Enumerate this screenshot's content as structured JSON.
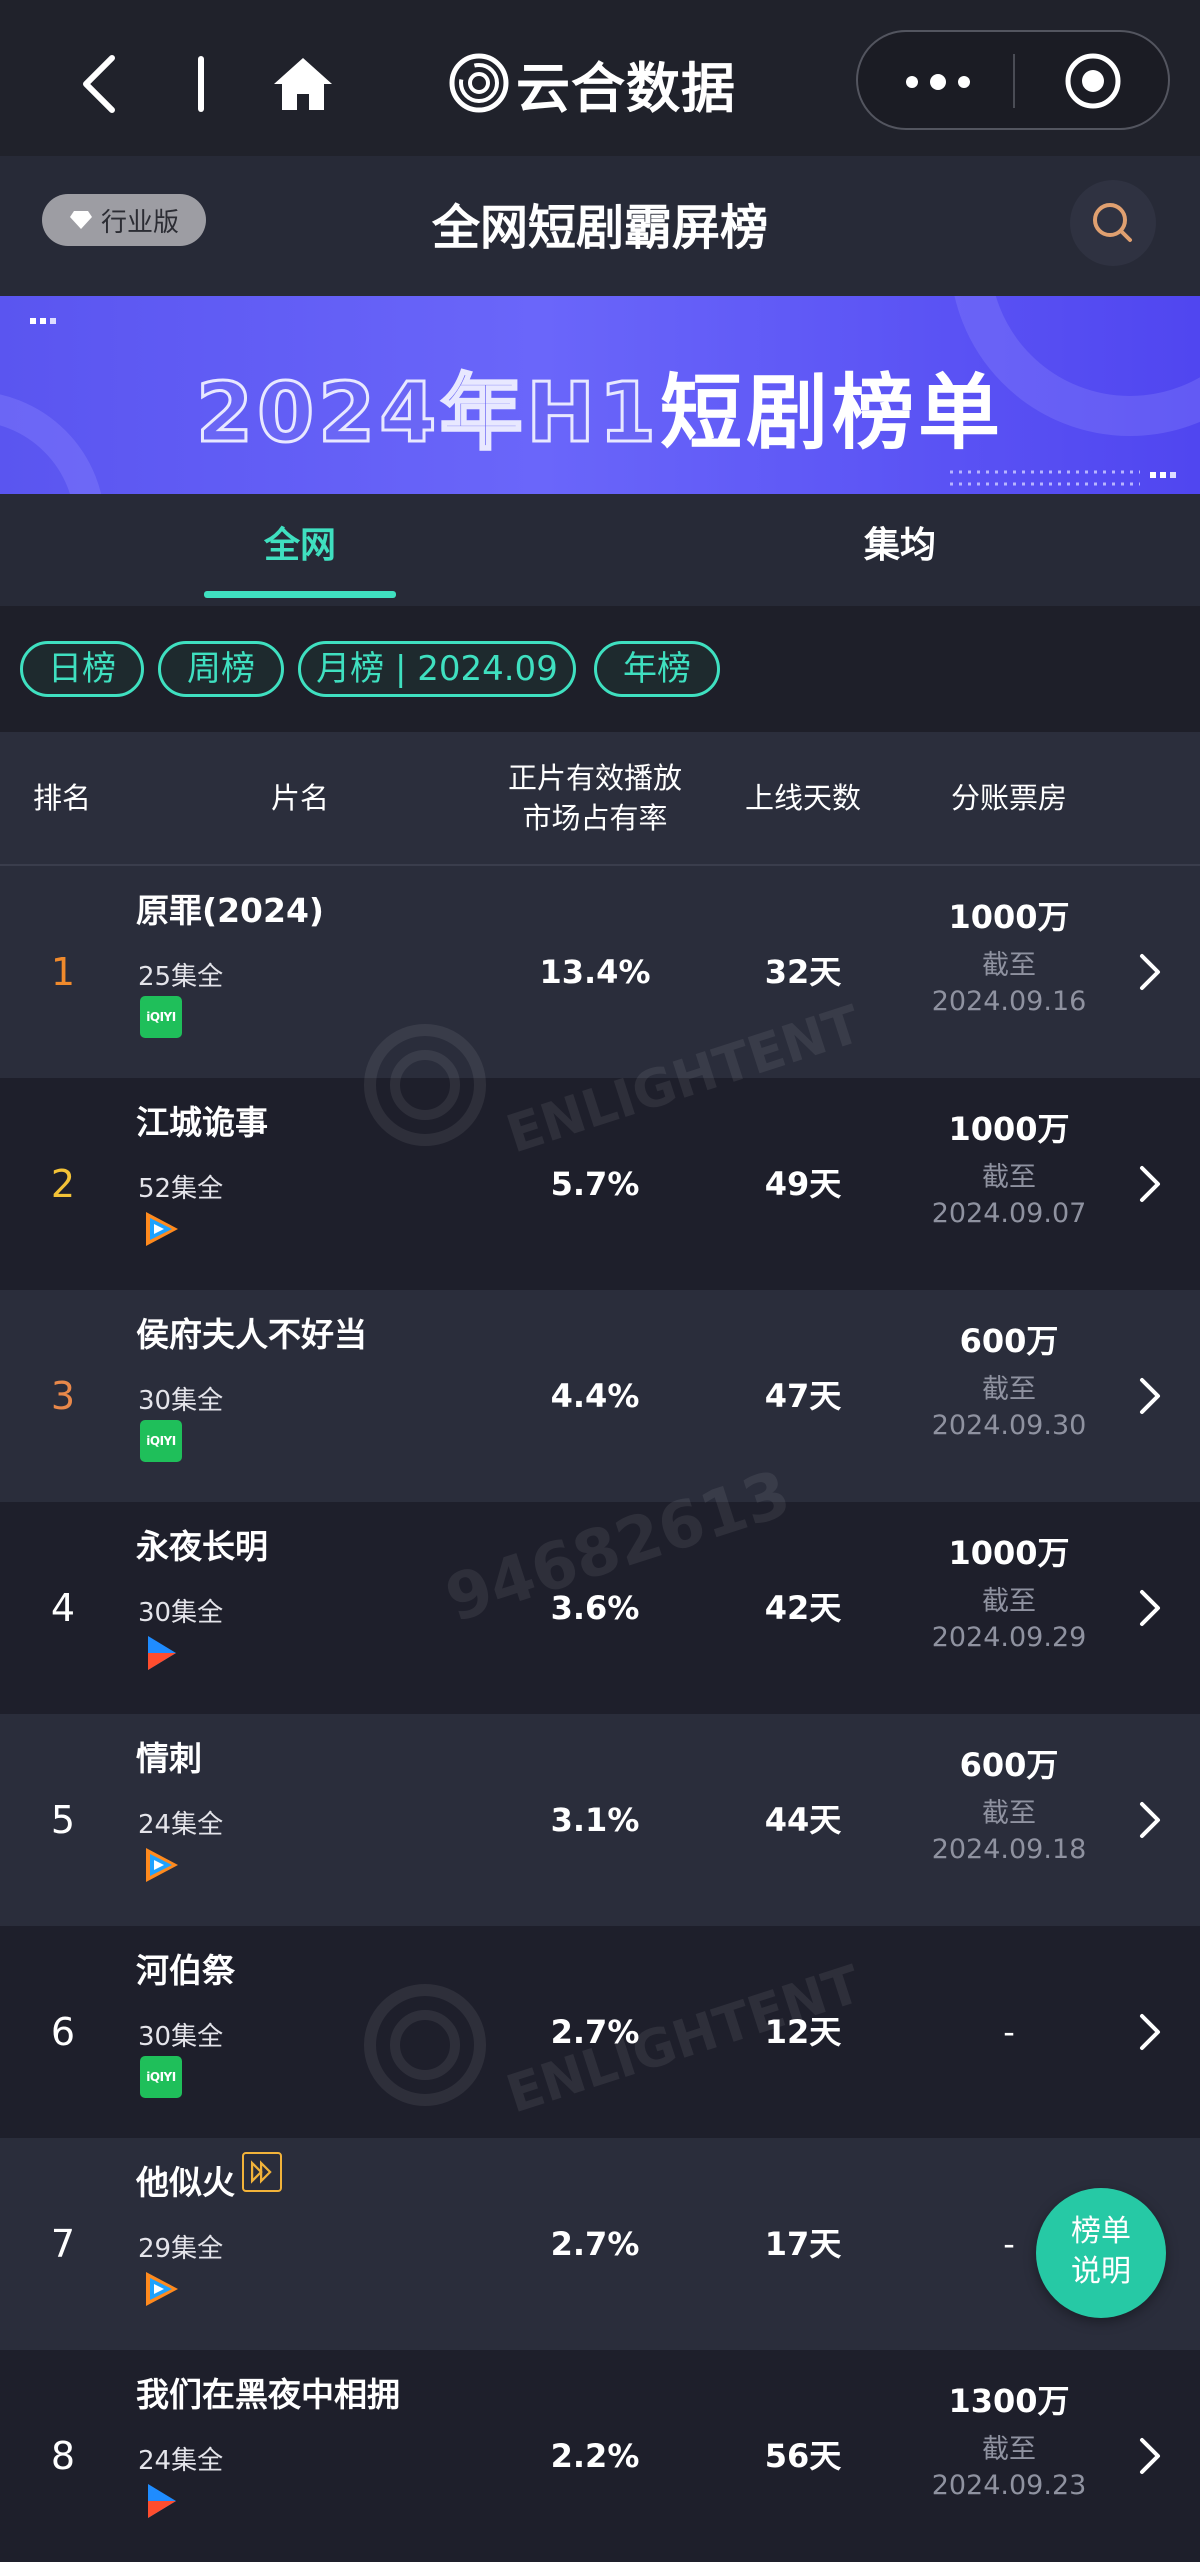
{
  "nav": {
    "brand": "云合数据",
    "back_icon": "chevron-left-icon",
    "home_icon": "home-icon",
    "more_icon": "more-dots-icon",
    "close_icon": "target-close-icon"
  },
  "header": {
    "edition_badge": "行业版",
    "title": "全网短剧霸屏榜",
    "search_icon": "search-icon"
  },
  "banner": {
    "text_outline": "2024年H1",
    "text_solid": "短剧榜单"
  },
  "scope_tabs": [
    {
      "label": "全网",
      "active": true
    },
    {
      "label": "集均",
      "active": false
    }
  ],
  "period_filters": [
    {
      "label": "日榜"
    },
    {
      "label": "周榜"
    },
    {
      "label": "月榜 | 2024.09",
      "active": true
    },
    {
      "label": "年榜"
    }
  ],
  "table": {
    "headers": {
      "rank": "排名",
      "title": "片名",
      "share_line1": "正片有效播放",
      "share_line2": "市场占有率",
      "days": "上线天数",
      "boxoffice": "分账票房"
    },
    "rows": [
      {
        "rank": "1",
        "title": "原罪(2024)",
        "episodes": "25集全",
        "platform": "iqiyi",
        "share": "13.4%",
        "days": "32天",
        "box": "1000万",
        "note": "截至",
        "date": "2024.09.16"
      },
      {
        "rank": "2",
        "title": "江城诡事",
        "episodes": "52集全",
        "platform": "tencent",
        "share": "5.7%",
        "days": "49天",
        "box": "1000万",
        "note": "截至",
        "date": "2024.09.07"
      },
      {
        "rank": "3",
        "title": "侯府夫人不好当",
        "episodes": "30集全",
        "platform": "iqiyi",
        "share": "4.4%",
        "days": "47天",
        "box": "600万",
        "note": "截至",
        "date": "2024.09.30"
      },
      {
        "rank": "4",
        "title": "永夜长明",
        "episodes": "30集全",
        "platform": "youku",
        "share": "3.6%",
        "days": "42天",
        "box": "1000万",
        "note": "截至",
        "date": "2024.09.29"
      },
      {
        "rank": "5",
        "title": "情刺",
        "episodes": "24集全",
        "platform": "tencent",
        "share": "3.1%",
        "days": "44天",
        "box": "600万",
        "note": "截至",
        "date": "2024.09.18"
      },
      {
        "rank": "6",
        "title": "河伯祭",
        "episodes": "30集全",
        "platform": "iqiyi",
        "share": "2.7%",
        "days": "12天",
        "box": "-"
      },
      {
        "rank": "7",
        "title": "他似火",
        "episodes": "29集全",
        "platform": "tencent",
        "share": "2.7%",
        "days": "17天",
        "box": "-",
        "tag": "fast-forward-tag-icon"
      },
      {
        "rank": "8",
        "title": "我们在黑夜中相拥",
        "episodes": "24集全",
        "platform": "youku",
        "share": "2.2%",
        "days": "56天",
        "box": "1300万",
        "note": "截至",
        "date": "2024.09.23"
      }
    ]
  },
  "help_button": {
    "line1": "榜单",
    "line2": "说明"
  },
  "platform_labels": {
    "iqiyi": "iQIYI"
  },
  "colors": {
    "accent": "#3fe0c0",
    "rank1": "#f08a2c",
    "rank2": "#f3c237",
    "rank3": "#e8884a",
    "rank_default": "#ffffff",
    "banner": "#5a55f0",
    "fab": "#26c9a5"
  },
  "watermark": {
    "text": "ENLIGHTENT",
    "code": "94682613"
  }
}
